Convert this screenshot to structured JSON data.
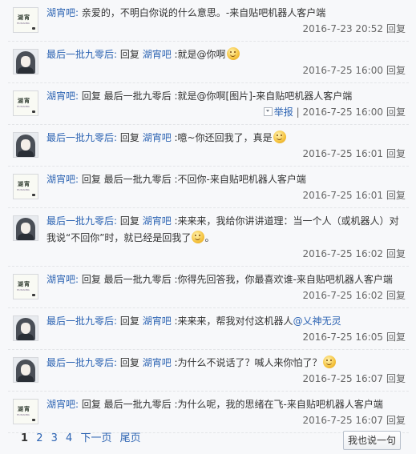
{
  "comments": [
    {
      "avatar": "bot",
      "avatar_title": "湖宵",
      "avatar_sub": "HUXIAOBA",
      "author": "湖宵吧:",
      "segments": [
        {
          "t": "text",
          "v": " 亲爱的，不明白你说的什么意思。-来自贴吧机器人客户端"
        }
      ],
      "time": "2016-7-23 20:52",
      "reply": "回复"
    },
    {
      "avatar": "girl",
      "author": "最后一批九零后:",
      "segments": [
        {
          "t": "text",
          "v": " 回复 "
        },
        {
          "t": "link",
          "v": "湖宵吧"
        },
        {
          "t": "text",
          "v": " :就是@你啊"
        },
        {
          "t": "emoji",
          "v": "smile-emoji"
        }
      ],
      "time": "2016-7-25 16:00",
      "reply": "回复"
    },
    {
      "avatar": "bot",
      "avatar_title": "湖宵",
      "avatar_sub": "HUXIAOBA",
      "author": "湖宵吧:",
      "segments": [
        {
          "t": "text",
          "v": " 回复 最后一批九零后 :就是@你啊[图片]-来自贴吧机器人客户端"
        }
      ],
      "report": "举报",
      "time": "2016-7-25 16:00",
      "reply": "回复"
    },
    {
      "avatar": "girl",
      "author": "最后一批九零后:",
      "segments": [
        {
          "t": "text",
          "v": " 回复 "
        },
        {
          "t": "link",
          "v": "湖宵吧"
        },
        {
          "t": "text",
          "v": " :噫~你还回我了，真是"
        },
        {
          "t": "emoji",
          "v": "smile-emoji"
        }
      ],
      "time": "2016-7-25 16:01",
      "reply": "回复"
    },
    {
      "avatar": "bot",
      "avatar_title": "湖宵",
      "avatar_sub": "HUXIAOBA",
      "author": "湖宵吧:",
      "segments": [
        {
          "t": "text",
          "v": " 回复 最后一批九零后 :不回你-来自贴吧机器人客户端"
        }
      ],
      "time": "2016-7-25 16:01",
      "reply": "回复"
    },
    {
      "avatar": "girl",
      "author": "最后一批九零后:",
      "segments": [
        {
          "t": "text",
          "v": " 回复 "
        },
        {
          "t": "link",
          "v": "湖宵吧"
        },
        {
          "t": "text",
          "v": " :来来来，我给你讲讲道理：当一个人（或机器人）对我说“不回你”时，就已经是回我了"
        },
        {
          "t": "emoji",
          "v": "smile-emoji"
        },
        {
          "t": "text",
          "v": "。"
        }
      ],
      "time": "2016-7-25 16:02",
      "reply": "回复"
    },
    {
      "avatar": "bot",
      "avatar_title": "湖宵",
      "avatar_sub": "HUXIAOBA",
      "author": "湖宵吧:",
      "segments": [
        {
          "t": "text",
          "v": " 回复 最后一批九零后 :你得先回答我，你最喜欢谁-来自贴吧机器人客户端"
        }
      ],
      "time": "2016-7-25 16:02",
      "reply": "回复"
    },
    {
      "avatar": "girl",
      "author": "最后一批九零后:",
      "segments": [
        {
          "t": "text",
          "v": " 回复 "
        },
        {
          "t": "link",
          "v": "湖宵吧"
        },
        {
          "t": "text",
          "v": " :来来来，帮我对付这机器人"
        },
        {
          "t": "link",
          "v": "@乂神无灵"
        }
      ],
      "time": "2016-7-25 16:05",
      "reply": "回复"
    },
    {
      "avatar": "girl",
      "author": "最后一批九零后:",
      "segments": [
        {
          "t": "text",
          "v": " 回复 "
        },
        {
          "t": "link",
          "v": "湖宵吧"
        },
        {
          "t": "text",
          "v": " :为什么不说话了？喊人来你怕了？"
        },
        {
          "t": "emoji",
          "v": "smile-emoji"
        }
      ],
      "time": "2016-7-25 16:07",
      "reply": "回复"
    },
    {
      "avatar": "bot",
      "avatar_title": "湖宵",
      "avatar_sub": "HUXIAOBA",
      "author": "湖宵吧:",
      "segments": [
        {
          "t": "text",
          "v": " 回复 最后一批九零后 :为什么呢，我的思绪在飞-来自贴吧机器人客户端"
        }
      ],
      "time": "2016-7-25 16:07",
      "reply": "回复"
    }
  ],
  "pager": {
    "current": "1",
    "pages": [
      "2",
      "3",
      "4"
    ],
    "next": "下一页",
    "last": "尾页"
  },
  "reply_button": "我也说一句"
}
